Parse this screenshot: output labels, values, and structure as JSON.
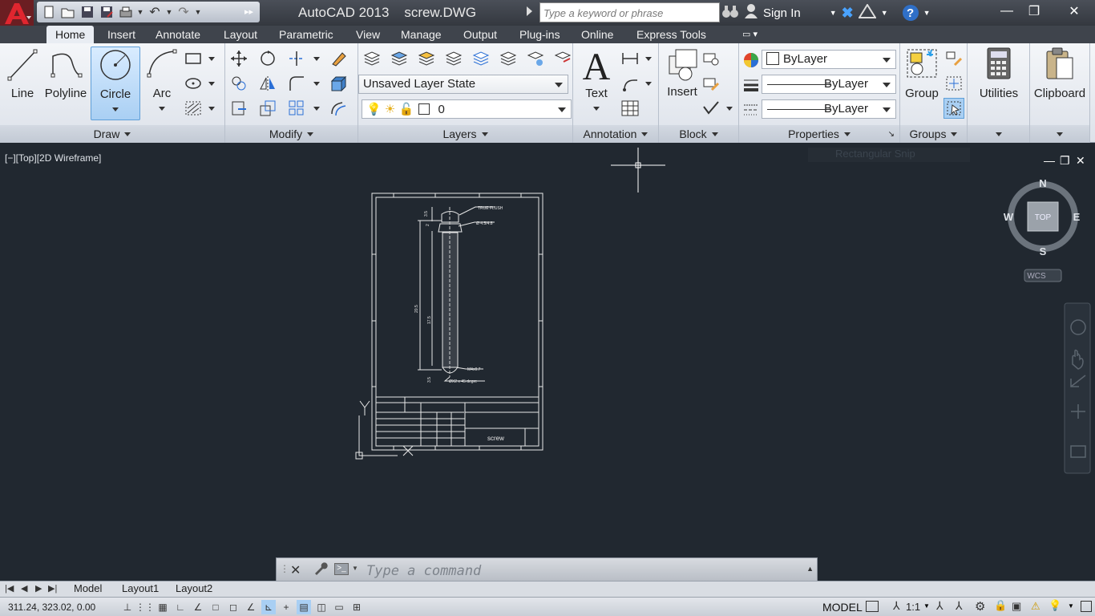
{
  "titlebar": {
    "app_name": "AutoCAD 2013",
    "document": "screw.DWG",
    "search_placeholder": "Type a keyword or phrase",
    "sign_in": "Sign In"
  },
  "tabs": [
    "Home",
    "Insert",
    "Annotate",
    "Layout",
    "Parametric",
    "View",
    "Manage",
    "Output",
    "Plug-ins",
    "Online",
    "Express Tools"
  ],
  "draw": {
    "title": "Draw",
    "line": "Line",
    "polyline": "Polyline",
    "circle": "Circle",
    "arc": "Arc"
  },
  "modify": {
    "title": "Modify"
  },
  "layers": {
    "title": "Layers",
    "layer_state": "Unsaved Layer State",
    "current_layer": "0"
  },
  "annotation": {
    "title": "Annotation",
    "text": "Text"
  },
  "block": {
    "title": "Block",
    "insert": "Insert"
  },
  "properties": {
    "title": "Properties",
    "color": "ByLayer",
    "lineweight": "ByLayer",
    "linetype": "ByLayer"
  },
  "groups": {
    "title": "Groups",
    "group": "Group"
  },
  "utilities": {
    "label": "Utilities"
  },
  "clipboard": {
    "label": "Clipboard"
  },
  "viewport": {
    "label": "[−][Top][2D Wireframe]",
    "compass_n": "N",
    "compass_s": "S",
    "compass_e": "E",
    "compass_w": "W",
    "cube_face": "TOP",
    "wcs": "WCS",
    "ghost_text": "Rectangular Snip",
    "drawing": {
      "notes": [
        "TRUE FLUSH",
        "Ø 4.5/4.8",
        "M4x0.7",
        "ØX2 x 45 degre"
      ],
      "dims": [
        "3.5",
        "2",
        "20.5",
        "17.5",
        "3.5"
      ],
      "title_block_name": "screw"
    }
  },
  "command": {
    "placeholder": "Type a command"
  },
  "layout_tabs": [
    "Model",
    "Layout1",
    "Layout2"
  ],
  "status": {
    "coords": "311.24, 323.02, 0.00",
    "space": "MODEL",
    "scale": "1:1"
  },
  "colors": {
    "accent_red": "#c8202a",
    "viewport_bg": "#212830",
    "ribbon_bg": "#e9edf3"
  }
}
